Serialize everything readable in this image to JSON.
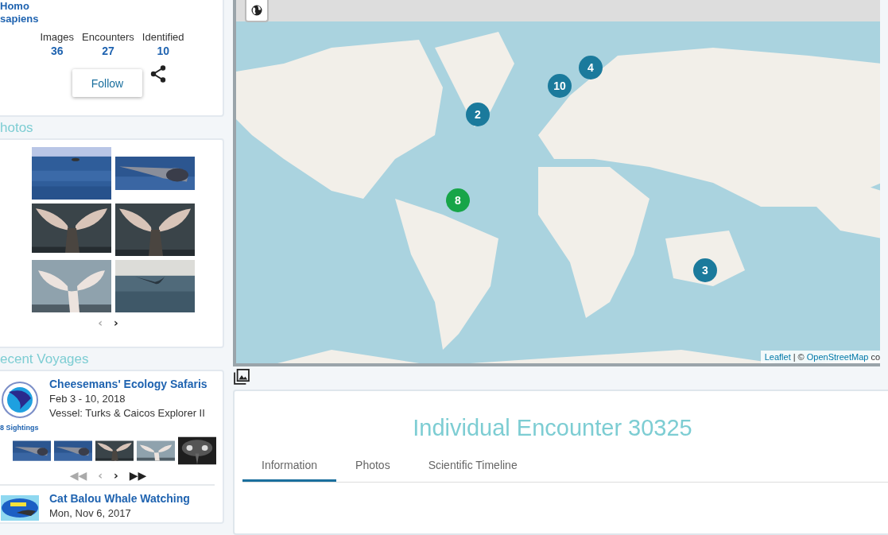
{
  "profile": {
    "species": [
      "Homo",
      "sapiens"
    ],
    "stats": [
      {
        "label": "Images",
        "value": "36"
      },
      {
        "label": "Encounters",
        "value": "27"
      },
      {
        "label": "Identified",
        "value": "10"
      }
    ],
    "follow_button": "Follow"
  },
  "photos_section": {
    "heading": "hotos",
    "photos": [
      {
        "kind": "picture"
      },
      {
        "kind": "picture"
      },
      {
        "kind": "picture"
      },
      {
        "kind": "picture"
      },
      {
        "kind": "picture"
      },
      {
        "kind": "picture"
      }
    ],
    "pager": [
      {
        "symbol": "‹",
        "disabled": true
      },
      {
        "symbol": "›",
        "disabled": false
      }
    ]
  },
  "voyages_section": {
    "heading": "ecent Voyages",
    "voyages": [
      {
        "title": "Cheesemans' Ecology Safaris",
        "date": "Feb 3 - 10, 2018",
        "vessel": "Vessel: Turks & Caicos Explorer II",
        "sightings": "8 Sightings",
        "thumbnails": [
          {
            "kind": "picture"
          },
          {
            "kind": "picture"
          },
          {
            "kind": "picture"
          },
          {
            "kind": "picture"
          },
          {
            "kind": "picture"
          }
        ],
        "pager": [
          {
            "symbol": "◀◀",
            "disabled": true
          },
          {
            "symbol": "‹",
            "disabled": true
          },
          {
            "symbol": "›",
            "disabled": false
          },
          {
            "symbol": "▶▶",
            "disabled": false
          }
        ]
      },
      {
        "title": "Cat Balou Whale Watching",
        "date": "Mon, Nov 6, 2017"
      }
    ]
  },
  "map": {
    "markers": [
      {
        "count": "2",
        "color": "#1b7a9c"
      },
      {
        "count": "10",
        "color": "#1b7a9c"
      },
      {
        "count": "4",
        "color": "#1b7a9c"
      },
      {
        "count": "8",
        "color": "#17a548"
      },
      {
        "count": "3",
        "color": "#1b7a9c"
      }
    ],
    "attribution": {
      "link_1": "Leaflet",
      "text_1": "| ©",
      "link_2": "OpenStreetMap",
      "text_2": "co"
    }
  },
  "encounter": {
    "title": "Individual Encounter 30325",
    "tabs": [
      {
        "label": "Information",
        "selected": true
      },
      {
        "label": "Photos",
        "selected": false
      },
      {
        "label": "Scientific Timeline",
        "selected": false
      }
    ]
  }
}
